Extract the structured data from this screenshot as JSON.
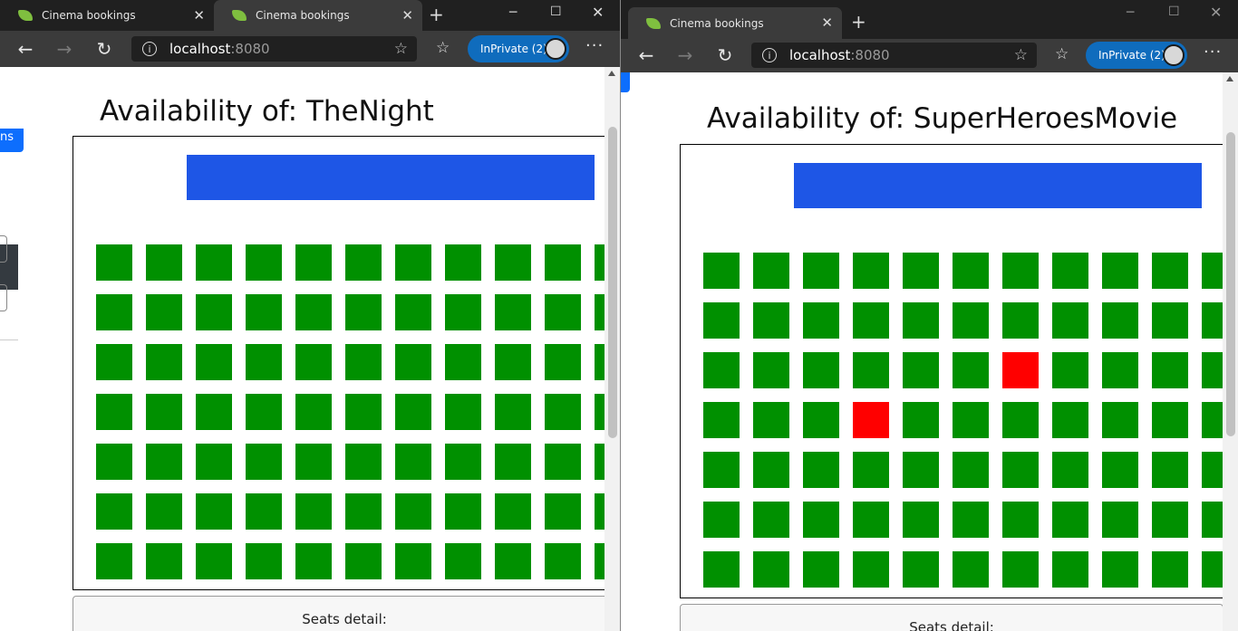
{
  "left_window": {
    "tabs": [
      {
        "title": "Cinema bookings",
        "active": false
      },
      {
        "title": "Cinema bookings",
        "active": true
      }
    ],
    "address": {
      "host": "localhost",
      "port": ":8080"
    },
    "profile_label": "InPrivate (2)",
    "behind_button_text": "ns",
    "page": {
      "heading": "Availability of: TheNight",
      "seat_rows": [
        [
          "free",
          "free",
          "free",
          "free",
          "free",
          "free",
          "free",
          "free",
          "free",
          "free",
          "free"
        ],
        [
          "free",
          "free",
          "free",
          "free",
          "free",
          "free",
          "free",
          "free",
          "free",
          "free",
          "free"
        ],
        [
          "free",
          "free",
          "free",
          "free",
          "free",
          "free",
          "free",
          "free",
          "free",
          "free",
          "free"
        ],
        [
          "free",
          "free",
          "free",
          "free",
          "free",
          "free",
          "free",
          "free",
          "free",
          "free",
          "free"
        ],
        [
          "free",
          "free",
          "free",
          "free",
          "free",
          "free",
          "free",
          "free",
          "free",
          "free",
          "free"
        ],
        [
          "free",
          "free",
          "free",
          "free",
          "free",
          "free",
          "free",
          "free",
          "free",
          "free",
          "free"
        ],
        [
          "free",
          "free",
          "free",
          "free",
          "free",
          "free",
          "free",
          "free",
          "free",
          "free",
          "free"
        ]
      ],
      "details_label": "Seats detail:"
    }
  },
  "right_window": {
    "tabs": [
      {
        "title": "Cinema bookings",
        "active": true
      }
    ],
    "address": {
      "host": "localhost",
      "port": ":8080"
    },
    "profile_label": "InPrivate (2)",
    "page": {
      "heading": "Availability of: SuperHeroesMovie",
      "seat_rows": [
        [
          "free",
          "free",
          "free",
          "free",
          "free",
          "free",
          "free",
          "free",
          "free",
          "free",
          "free"
        ],
        [
          "free",
          "free",
          "free",
          "free",
          "free",
          "free",
          "free",
          "free",
          "free",
          "free",
          "free"
        ],
        [
          "free",
          "free",
          "free",
          "free",
          "free",
          "free",
          "taken",
          "free",
          "free",
          "free",
          "free"
        ],
        [
          "free",
          "free",
          "free",
          "taken",
          "free",
          "free",
          "free",
          "free",
          "free",
          "free",
          "free"
        ],
        [
          "free",
          "free",
          "free",
          "free",
          "free",
          "free",
          "free",
          "free",
          "free",
          "free",
          "free"
        ],
        [
          "free",
          "free",
          "free",
          "free",
          "free",
          "free",
          "free",
          "free",
          "free",
          "free",
          "free"
        ],
        [
          "free",
          "free",
          "free",
          "free",
          "free",
          "free",
          "free",
          "free",
          "free",
          "free",
          "free"
        ]
      ],
      "details_label": "Seats detail:"
    }
  },
  "colors": {
    "seat_free": "#009000",
    "seat_taken": "#ff0000",
    "screen": "#1e56e6",
    "inprivate_badge": "#0f6cbd"
  },
  "icons": {
    "tab": "spring-leaf-icon",
    "back": "arrow-left-icon",
    "forward": "arrow-right-icon",
    "refresh": "refresh-icon",
    "site_info": "info-icon",
    "favorite": "star-icon",
    "favorites": "favorites-list-icon",
    "more": "more-dots-icon"
  }
}
